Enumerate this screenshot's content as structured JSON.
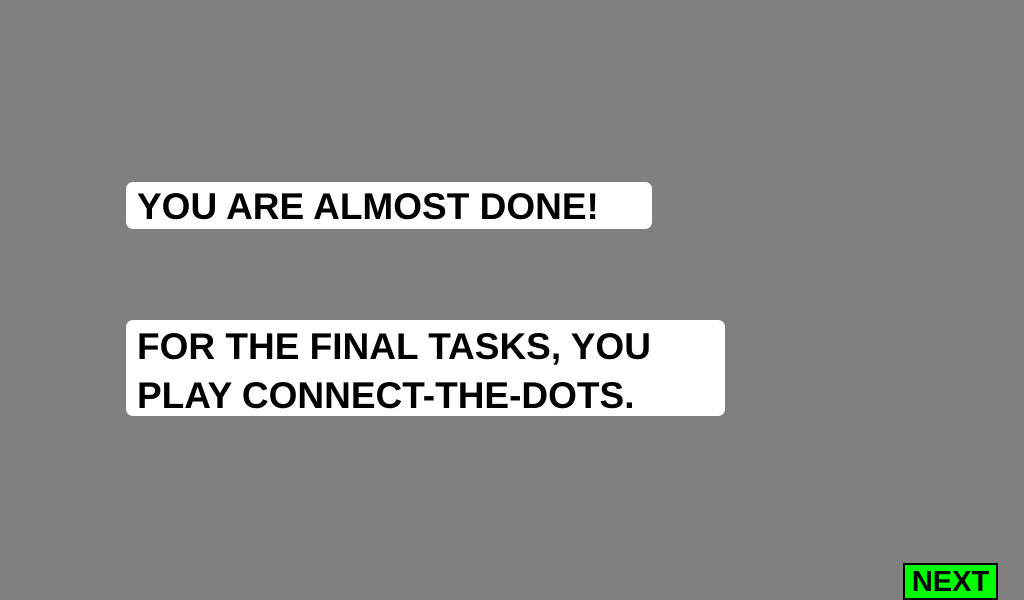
{
  "heading": "YOU ARE ALMOST DONE!",
  "instructions": {
    "line1": "FOR THE FINAL TASKS, YOU",
    "line2": "PLAY CONNECT-THE-DOTS."
  },
  "next_button": {
    "label": "NEXT",
    "color": "#00ff00"
  },
  "colors": {
    "background": "#808080",
    "panel": "#ffffff",
    "text": "#000000"
  }
}
